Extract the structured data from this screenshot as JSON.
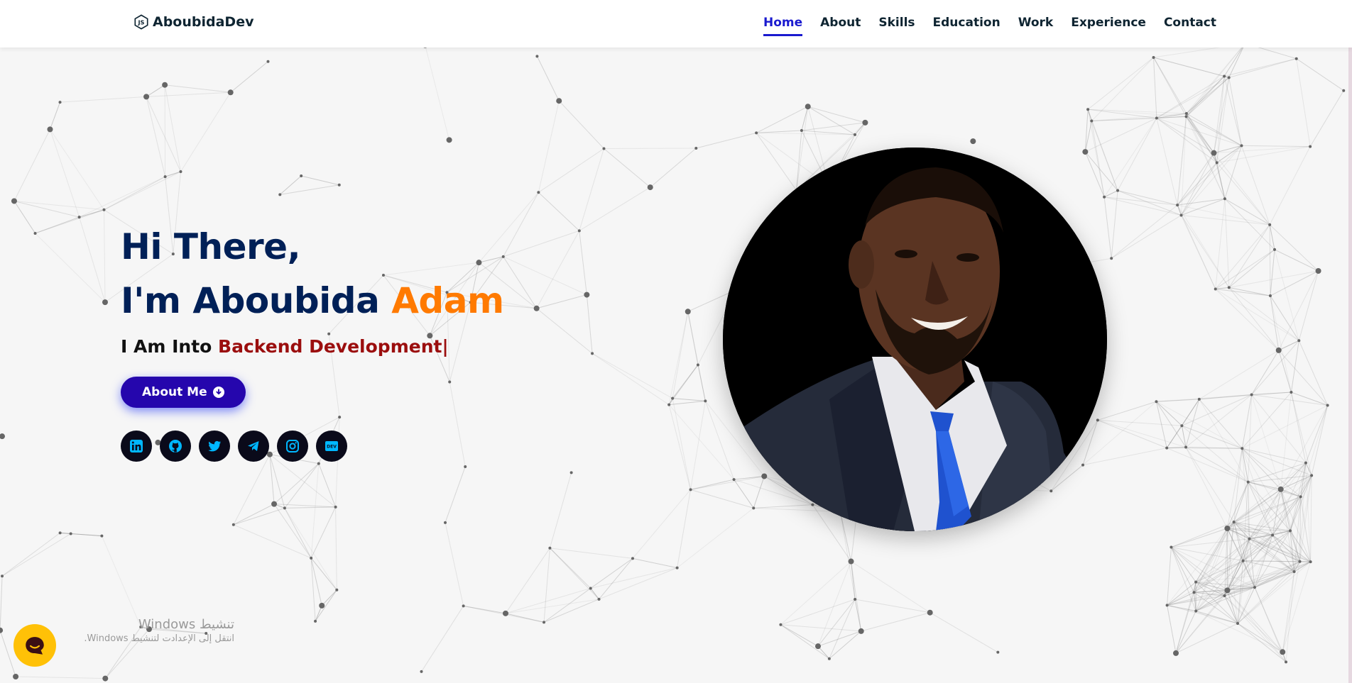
{
  "header": {
    "logo_text": "AboubidaDev",
    "logo_icon": "nodejs-hexagon-icon",
    "nav": [
      {
        "label": "Home",
        "active": true
      },
      {
        "label": "About",
        "active": false
      },
      {
        "label": "Skills",
        "active": false
      },
      {
        "label": "Education",
        "active": false
      },
      {
        "label": "Work",
        "active": false
      },
      {
        "label": "Experience",
        "active": false
      },
      {
        "label": "Contact",
        "active": false
      }
    ]
  },
  "hero": {
    "greeting": "Hi There,",
    "name_prefix": "I'm Aboubida ",
    "name_accent": "Adam",
    "typing_prefix": "I Am Into ",
    "typing_role": "Backend Development|",
    "button_label": "About Me",
    "button_icon": "arrow-circle-down-icon",
    "socials": [
      {
        "name": "linkedin-icon"
      },
      {
        "name": "github-icon"
      },
      {
        "name": "twitter-icon"
      },
      {
        "name": "telegram-icon"
      },
      {
        "name": "instagram-icon"
      },
      {
        "name": "dev-icon"
      }
    ]
  },
  "photo": {
    "alt": "profile-photo"
  },
  "chat_widget": {
    "icon": "chat-bubble-icon"
  },
  "watermark": {
    "line1": "تنشيط Windows",
    "line2": "انتقل إلى الإعدادت لتنشيط Windows."
  },
  "colors": {
    "navy": "#002057",
    "accent_orange": "#ff7a00",
    "role_red": "#9b0e0e",
    "button_blue": "#2506ad",
    "nav_active": "#1a1acf",
    "social_icon": "#00b7ff",
    "chat_yellow": "#ffc107"
  }
}
